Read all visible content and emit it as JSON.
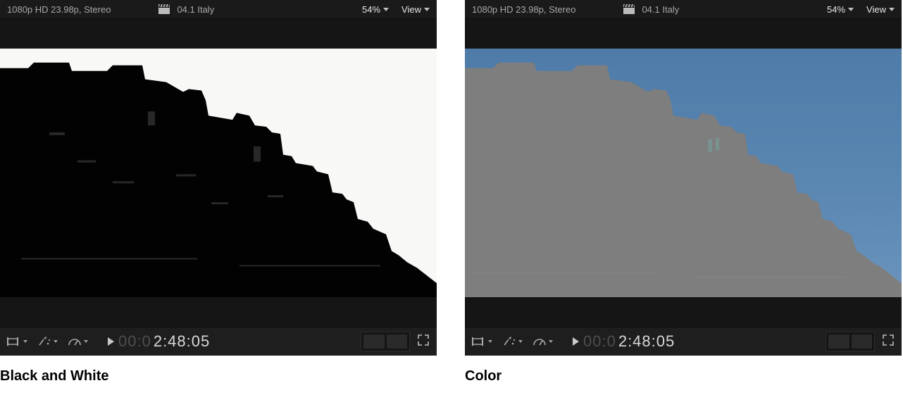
{
  "panels": [
    {
      "format_info": "1080p HD 23.98p, Stereo",
      "clip_name": "04.1 Italy",
      "zoom": "54%",
      "view_label": "View",
      "toolbar": {
        "trim_icon": "trim-icon",
        "retime_icon": "retime-icon",
        "speed_icon": "speed-gauge-icon",
        "play_icon": "play-icon",
        "tc_dim": "00:0",
        "tc_bright": "2:48:05",
        "fullscreen_icon": "fullscreen-icon"
      },
      "caption": "Black and White"
    },
    {
      "format_info": "1080p HD 23.98p, Stereo",
      "clip_name": "04.1 Italy",
      "zoom": "54%",
      "view_label": "View",
      "toolbar": {
        "trim_icon": "trim-icon",
        "retime_icon": "retime-icon",
        "speed_icon": "speed-gauge-icon",
        "play_icon": "play-icon",
        "tc_dim": "00:0",
        "tc_bright": "2:48:05",
        "fullscreen_icon": "fullscreen-icon"
      },
      "caption": "Color"
    }
  ]
}
